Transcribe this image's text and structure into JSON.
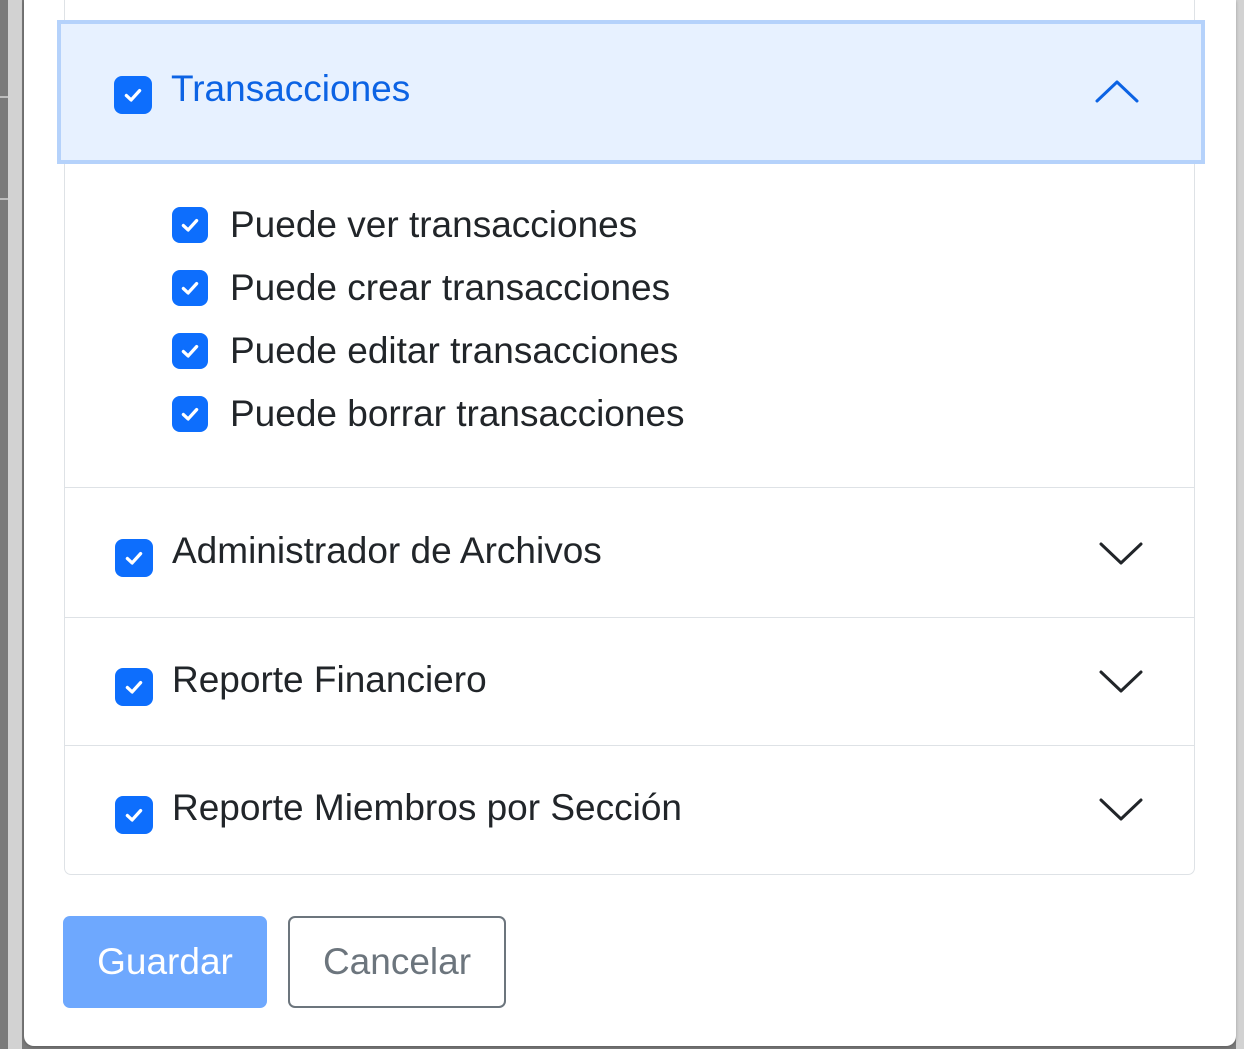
{
  "accordion": {
    "sections": [
      {
        "label": "Transacciones",
        "checked": true,
        "expanded": true,
        "permissions": [
          {
            "label": "Puede ver transacciones",
            "checked": true
          },
          {
            "label": "Puede crear transacciones",
            "checked": true
          },
          {
            "label": "Puede editar transacciones",
            "checked": true
          },
          {
            "label": "Puede borrar transacciones",
            "checked": true
          }
        ]
      },
      {
        "label": "Administrador de Archivos",
        "checked": true,
        "expanded": false
      },
      {
        "label": "Reporte Financiero",
        "checked": true,
        "expanded": false
      },
      {
        "label": "Reporte Miembros por Sección",
        "checked": true,
        "expanded": false
      }
    ]
  },
  "actions": {
    "save_label": "Guardar",
    "cancel_label": "Cancelar"
  },
  "colors": {
    "accent": "#0d6efd",
    "active_header_bg": "#e7f1ff",
    "active_header_text": "#0c63e4",
    "save_button_bg": "#6ea8fe",
    "cancel_button_text": "#6c757d"
  },
  "icons": {
    "checkbox": "check-icon",
    "expanded": "chevron-up-icon",
    "collapsed": "chevron-down-icon"
  }
}
